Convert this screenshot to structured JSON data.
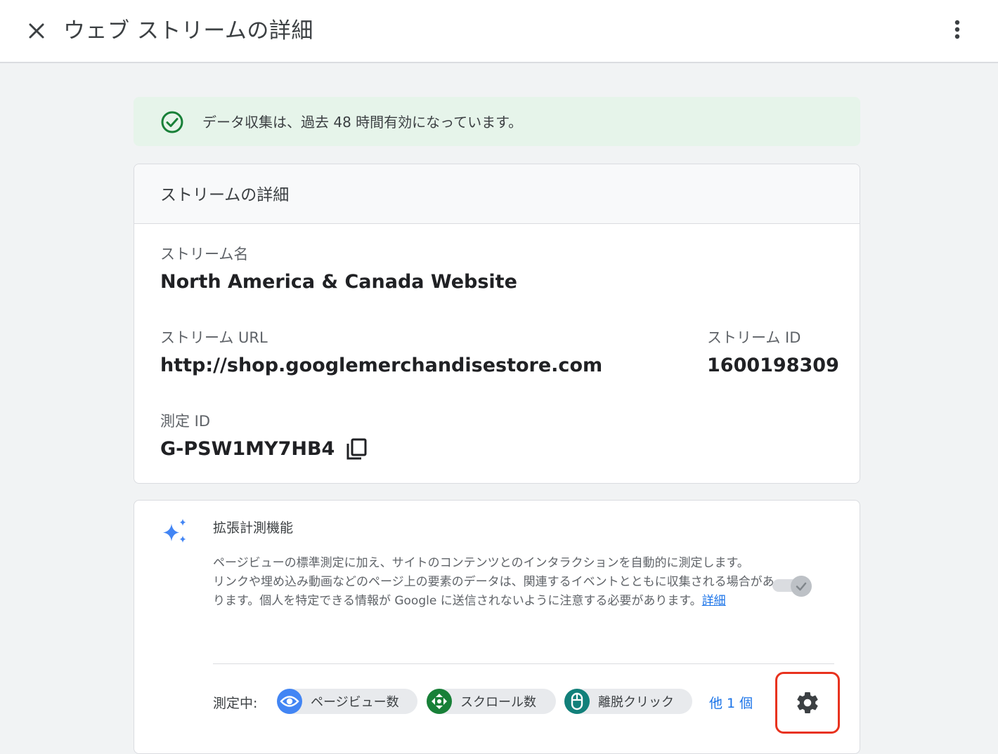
{
  "header": {
    "title": "ウェブ ストリームの詳細"
  },
  "banner": {
    "text": "データ収集は、過去 48 時間有効になっています。",
    "color": "#e6f4ea"
  },
  "details": {
    "title": "ストリームの詳細",
    "stream_name_label": "ストリーム名",
    "stream_name": "North America & Canada Website",
    "stream_url_label": "ストリーム URL",
    "stream_url": "http://shop.googlemerchandisestore.com",
    "stream_id_label": "ストリーム ID",
    "stream_id": "1600198309",
    "measurement_id_label": "測定 ID",
    "measurement_id": "G-PSW1MY7HB4"
  },
  "enhanced": {
    "title": "拡張計測機能",
    "desc_line1": "ページビューの標準測定に加え、サイトのコンテンツとのインタラクションを自動的に測定します。",
    "desc_line2": "リンクや埋め込み動画などのページ上の要素のデータは、関連するイベントとともに収集される場合があります。個人を特定できる情報が Google に送信されないように注意する必要があります。",
    "learn_more": "詳細",
    "toggle_on": true,
    "measuring_label": "測定中:",
    "chips": [
      {
        "label": "ページビュー数",
        "icon": "eye-icon",
        "color": "#4285f4"
      },
      {
        "label": "スクロール数",
        "icon": "scroll-icon",
        "color": "#188038"
      },
      {
        "label": "離脱クリック",
        "icon": "mouse-icon",
        "color": "#12807a"
      }
    ],
    "more": "他 1 個"
  },
  "colors": {
    "accent": "#1a73e8",
    "success": "#188038",
    "highlight": "#e8321e"
  }
}
